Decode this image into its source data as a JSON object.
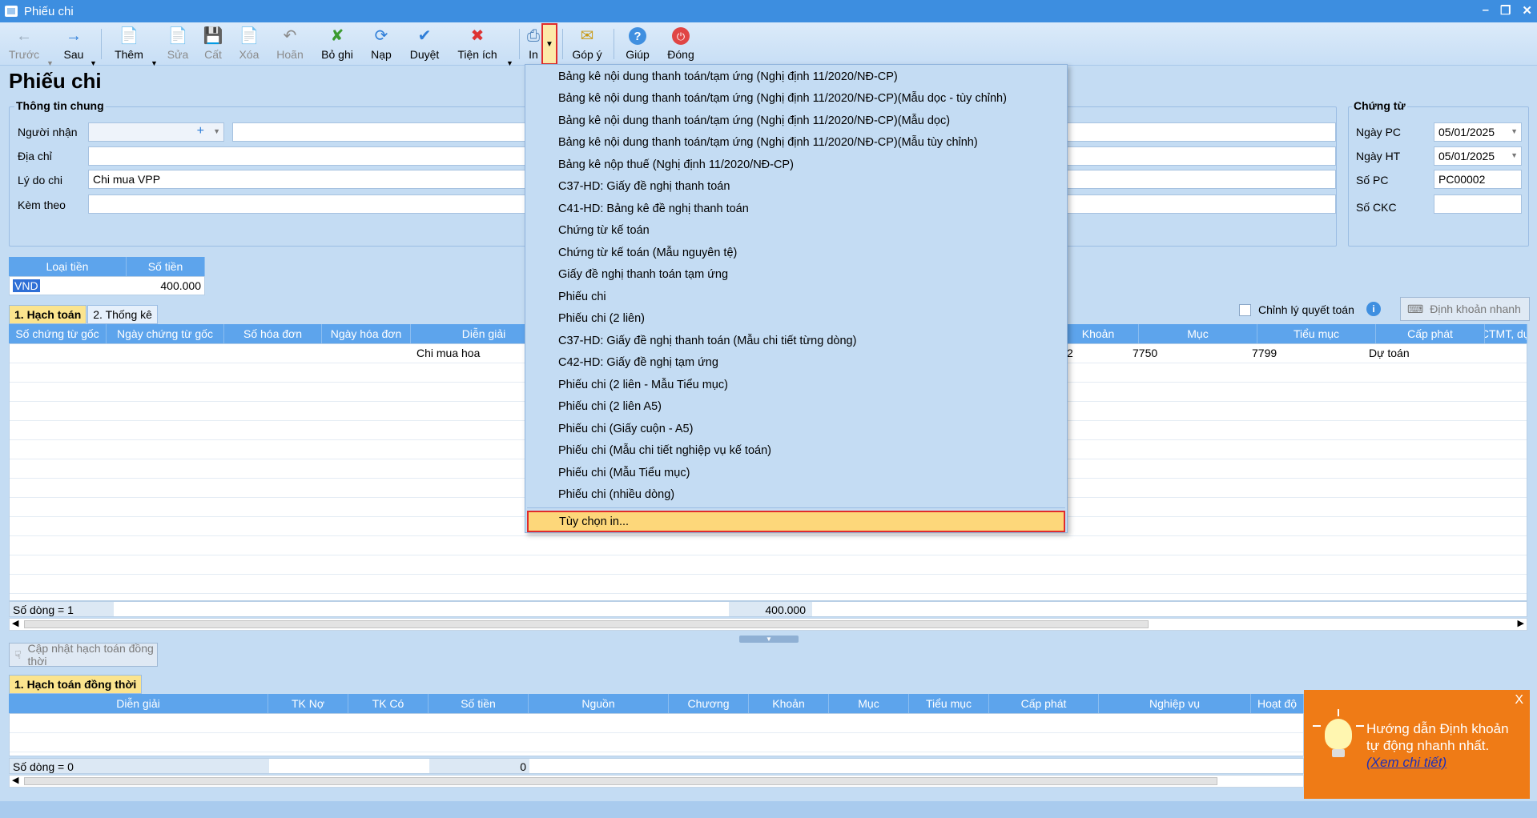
{
  "window": {
    "title": "Phiếu chi",
    "min": "–",
    "restore": "❐",
    "close": "✕"
  },
  "toolbar": {
    "prev": "Trước",
    "next": "Sau",
    "add": "Thêm",
    "edit": "Sửa",
    "save": "Cất",
    "delete": "Xóa",
    "undo": "Hoãn",
    "unpost": "Bỏ ghi",
    "reload": "Nạp",
    "approve": "Duyệt",
    "utilities": "Tiện ích",
    "print": "In",
    "feedback": "Góp ý",
    "help": "Giúp",
    "close": "Đóng"
  },
  "page_title": "Phiếu chi",
  "general": {
    "legend": "Thông tin chung",
    "recipient_label": "Người nhận",
    "recipient_value": "",
    "address_label": "Địa chỉ",
    "address_value": "",
    "reason_label": "Lý do chi",
    "reason_value": "Chi mua VPP",
    "attach_label": "Kèm theo",
    "attach_value": ""
  },
  "voucher": {
    "legend": "Chứng từ",
    "date_pc_label": "Ngày PC",
    "date_pc": "05/01/2025",
    "date_ht_label": "Ngày HT",
    "date_ht": "05/01/2025",
    "no_pc_label": "Số PC",
    "no_pc": "PC00002",
    "no_ckc_label": "Số CKC",
    "no_ckc": ""
  },
  "currency": {
    "headers": [
      "Loại tiền",
      "Số tiền"
    ],
    "row": {
      "type": "VND",
      "amount": "400.000"
    }
  },
  "tabs": {
    "posting": "1. Hạch toán",
    "stats": "2. Thống kê"
  },
  "adjust_label": "Chỉnh lý quyết toán",
  "quick_entry": "Định khoản nhanh",
  "main_grid": {
    "headers_left": [
      "Số chứng từ gốc",
      "Ngày chứng từ gốc",
      "Số hóa đơn",
      "Ngày hóa đơn",
      "Diễn giải"
    ],
    "headers_right": [
      "Khoản",
      "Mục",
      "Tiểu mục",
      "Cấp phát",
      "CTMT, dự"
    ],
    "row": {
      "desc": "Chi mua hoa",
      "khoan": "2",
      "muc": "7750",
      "tieumuc": "7799",
      "capphat": "Dự toán"
    },
    "footer_count": "Số dòng = 1",
    "footer_total": "400.000"
  },
  "sync_button": "Cập nhật hạch toán đồng thời",
  "sync_tab": "1. Hạch toán đồng thời",
  "sync_grid": {
    "headers": [
      "Diễn giải",
      "TK Nợ",
      "TK Có",
      "Số tiền",
      "Nguồn",
      "Chương",
      "Khoản",
      "Mục",
      "Tiểu mục",
      "Cấp phát",
      "Nghiệp vụ",
      "Hoạt độ"
    ],
    "footer_count": "Số dòng = 0",
    "footer_total": "0"
  },
  "print_menu": {
    "items": [
      "Bảng kê nội dung thanh toán/tạm ứng (Nghị định 11/2020/NĐ-CP)",
      "Bảng kê nội dung thanh toán/tạm ứng (Nghị định 11/2020/NĐ-CP)(Mẫu dọc - tùy chỉnh)",
      "Bảng kê nội dung thanh toán/tạm ứng (Nghị định 11/2020/NĐ-CP)(Mẫu dọc)",
      "Bảng kê nội dung thanh toán/tạm ứng (Nghị định 11/2020/NĐ-CP)(Mẫu tùy chỉnh)",
      "Bảng kê nộp thuế (Nghị định 11/2020/NĐ-CP)",
      "C37-HD: Giấy đề nghị thanh toán",
      "C41-HD: Bảng kê đề nghị thanh toán",
      "Chứng từ kế toán",
      "Chứng từ kế toán (Mẫu nguyên tệ)",
      "Giấy đề nghị thanh toán tạm ứng",
      "Phiếu chi",
      "Phiếu chi (2 liên)",
      "C37-HD: Giấy đề nghị thanh toán (Mẫu chi tiết từng dòng)",
      "C42-HD: Giấy đề nghị tạm ứng",
      "Phiếu chi (2 liên - Mẫu Tiểu mục)",
      "Phiếu chi (2 liên A5)",
      "Phiếu chi (Giấy cuộn - A5)",
      "Phiếu chi (Mẫu chi tiết nghiệp vụ kế toán)",
      "Phiếu chi (Mẫu Tiểu mục)",
      "Phiếu chi (nhiều dòng)"
    ],
    "selected": "Tùy chọn in..."
  },
  "popup": {
    "close": "X",
    "line1": "Hướng dẫn Định khoản",
    "line2": "tự động nhanh nhất.",
    "link": "(Xem chi tiết)"
  }
}
